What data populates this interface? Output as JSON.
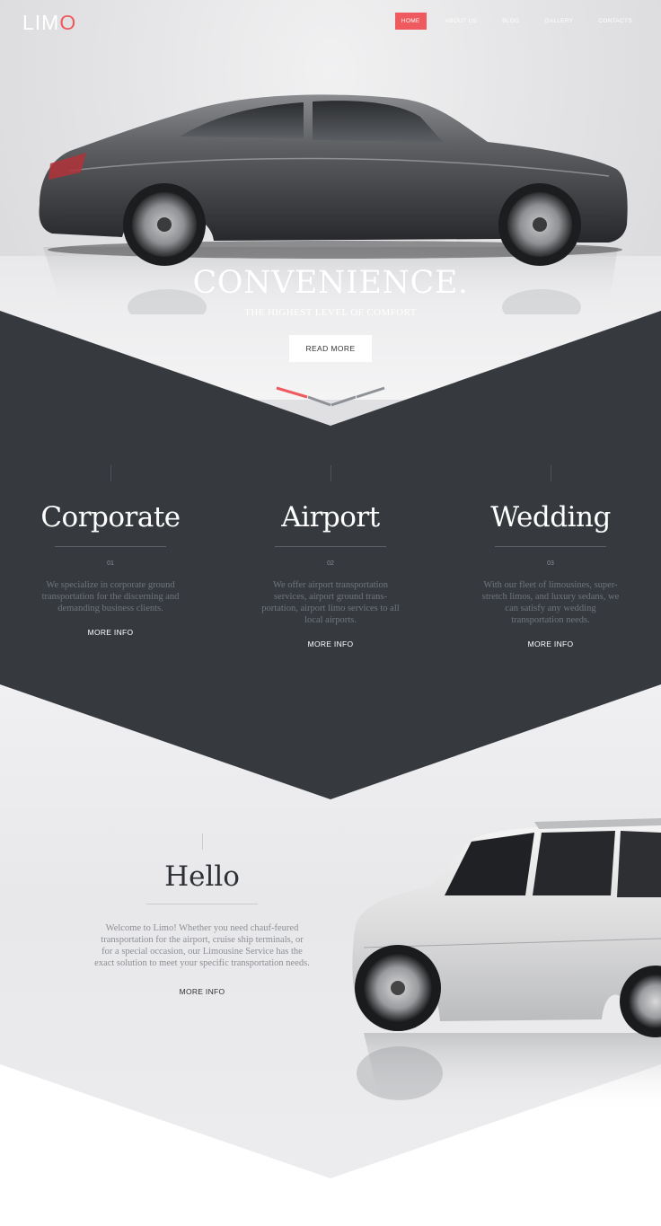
{
  "brand": {
    "name_prefix": "LIM",
    "name_accent": "O",
    "accent_color": "#ef5a5f"
  },
  "nav": {
    "items": [
      "HOME",
      "ABOUT US",
      "BLOG",
      "GALLERY",
      "CONTACTS"
    ],
    "active_index": 0
  },
  "hero": {
    "title": "CONVENIENCE.",
    "subtitle": "THE HIGHEST LEVEL OF COMFORT",
    "button_label": "READ MORE",
    "slider_dots": 3,
    "active_dot": 0
  },
  "services": [
    {
      "title": "Corporate",
      "number": "01",
      "text": "We specialize in corporate ground transportation for the discerning and demanding business clients.",
      "link": "MORE INFO"
    },
    {
      "title": "Airport",
      "number": "02",
      "text": "We offer airport transportation services, airport ground trans-portation, airport limo services to all local airports.",
      "link": "MORE INFO"
    },
    {
      "title": "Wedding",
      "number": "03",
      "text": "With our fleet of limousines, super-stretch limos, and luxury sedans, we can satisfy any wedding transportation needs.",
      "link": "MORE INFO"
    }
  ],
  "hello": {
    "title": "Hello",
    "text": "Welcome to Limo! Whether you need chauf-feured transportation for the airport, cruise ship terminals, or for a special occasion, our Limousine Service has the exact solution to meet your specific transportation needs.",
    "link": "MORE INFO"
  },
  "colors": {
    "dark": "#363a3f",
    "accent": "#ef5a5f",
    "light_bg": "#f0f0f2"
  }
}
